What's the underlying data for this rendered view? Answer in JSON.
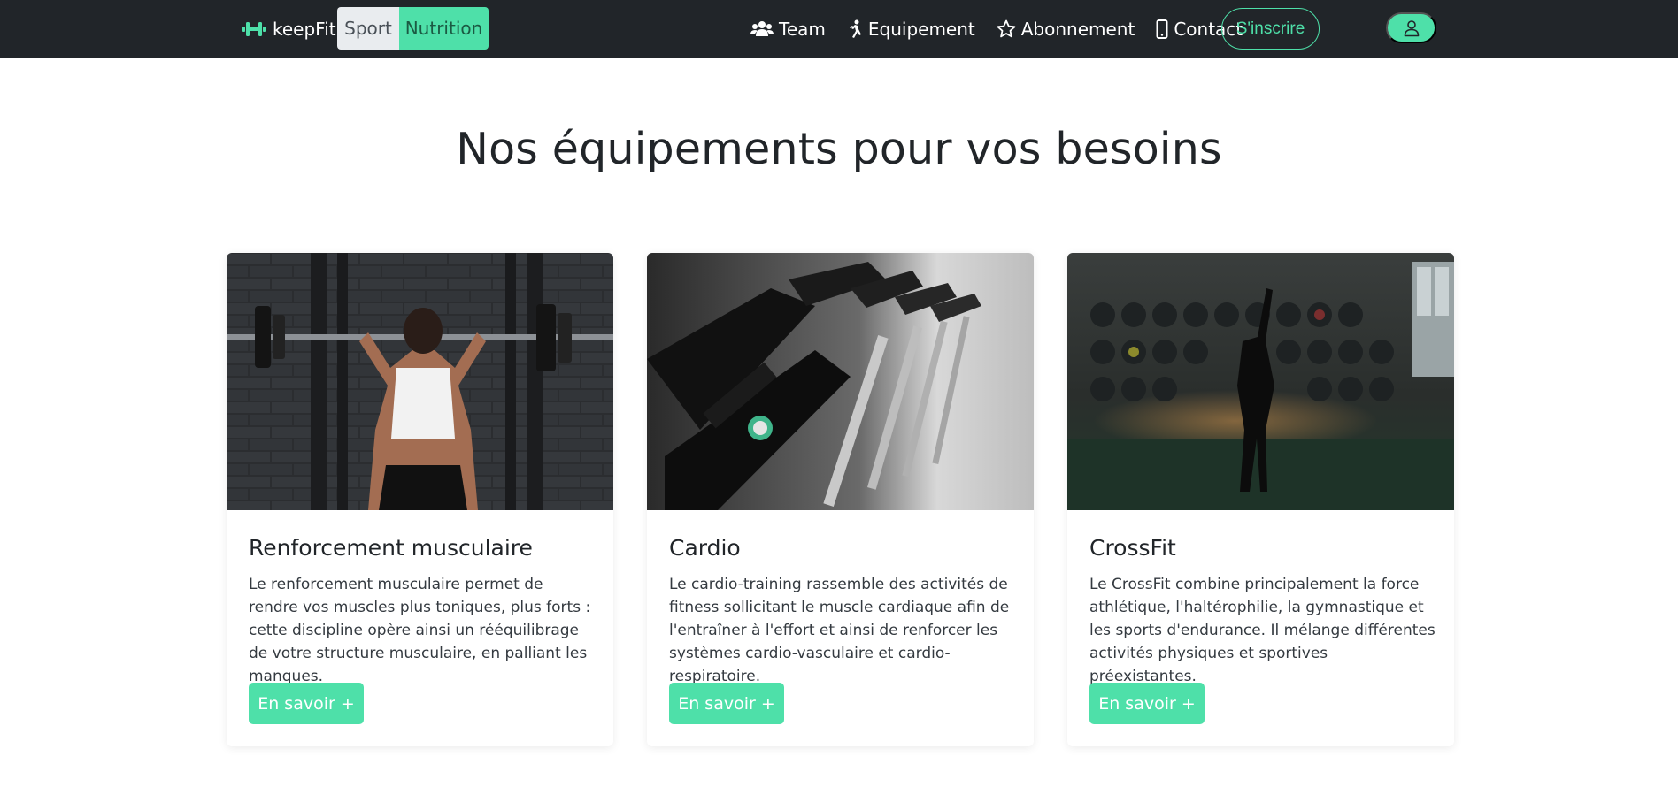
{
  "navbar": {
    "brand": "keepFit",
    "toggle": {
      "sport_label": "Sport",
      "nutrition_label": "Nutrition"
    },
    "links": [
      {
        "label": "Team",
        "icon": "users-icon"
      },
      {
        "label": "Equipement",
        "icon": "running-person-icon"
      },
      {
        "label": "Abonnement",
        "icon": "star-icon"
      },
      {
        "label": "Contact",
        "icon": "mobile-phone-icon"
      }
    ],
    "signup_label": "S'inscrire",
    "user_icon": "user-icon"
  },
  "main": {
    "title": "Nos équipements pour vos besoins",
    "cards": [
      {
        "title": "Renforcement musculaire",
        "text": "Le renforcement musculaire permet de rendre vos muscles plus toniques, plus forts : cette discipline opère ainsi un rééquilibrage de votre structure musculaire, en palliant les manques.",
        "button": "En savoir +"
      },
      {
        "title": "Cardio",
        "text": "Le cardio-training rassemble des activités de fitness sollicitant le muscle cardiaque afin de l'entraîner à l'effort et ainsi de renforcer les systèmes cardio-vasculaire et cardio-respiratoire.",
        "button": "En savoir +"
      },
      {
        "title": "CrossFit",
        "text": "Le CrossFit combine principalement la force athlétique, l'haltérophilie, la gymnastique et les sports d'endurance. Il mélange différentes activités physiques et sportives préexistantes.",
        "button": "En savoir +"
      }
    ]
  },
  "colors": {
    "accent": "#4ee0a9",
    "navbar_bg": "#212529",
    "text": "#212529"
  }
}
